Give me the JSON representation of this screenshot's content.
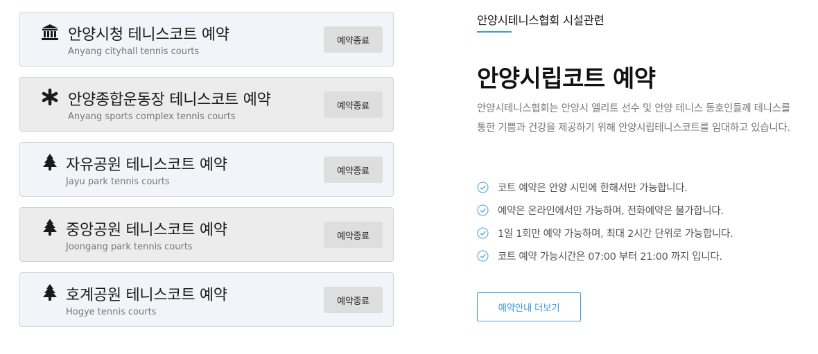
{
  "courts": [
    {
      "title": "안양시청 테니스코트 예약",
      "subtitle": "Anyang cityhall tennis courts",
      "button": "예약종료",
      "icon": "city-hall-icon"
    },
    {
      "title": "안양종합운동장 테니스코트 예약",
      "subtitle": "Anyang sports complex tennis courts",
      "button": "예약종료",
      "icon": "asterisk-icon"
    },
    {
      "title": "자유공원 테니스코트 예약",
      "subtitle": "Jayu park tennis courts",
      "button": "예약종료",
      "icon": "tree-icon"
    },
    {
      "title": "중앙공원 테니스코트 예약",
      "subtitle": "Joongang park tennis courts",
      "button": "예약종료",
      "icon": "tree-icon"
    },
    {
      "title": "호계공원 테니스코트 예약",
      "subtitle": "Hogye tennis courts",
      "button": "예약종료",
      "icon": "tree-icon"
    }
  ],
  "info": {
    "subtitle": "안양시테니스협회 시설관련",
    "title": "안양시립코트 예약",
    "description": "안양시테니스협회는 안양시 엘리트 선수 및 안양 테니스 동호인들께 테니스를 통한 기쁨과 건강을 제공하기 위해 안양시립테니스코트를 임대하고 있습니다.",
    "rules": [
      "코트 예약은 안양 시민에 한해서만 가능합니다.",
      "예약은 온라인에서만 가능하며, 전화예약은 불가합니다.",
      "1일 1회만 예약 가능하며, 최대 2시간 단위로 가능합니다.",
      "코트 예약 가능시간은 07:00 부터 21:00 까지 입니다."
    ],
    "more_button": "예약안내 더보기"
  },
  "colors": {
    "accent": "#3d9be0",
    "card_light": "#f1f4f8",
    "card_gray": "#ececec",
    "button_bg": "#dedede"
  }
}
